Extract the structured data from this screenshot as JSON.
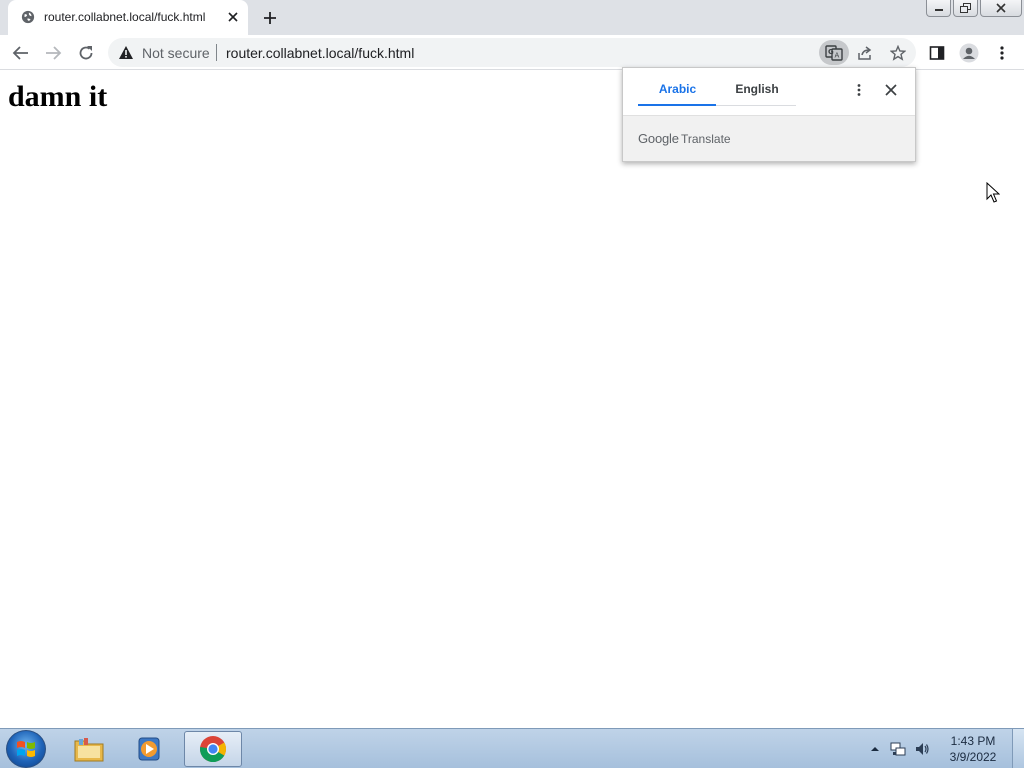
{
  "browser": {
    "tab": {
      "title": "router.collabnet.local/fuck.html",
      "favicon": "globe-icon"
    },
    "omnibox": {
      "security_label": "Not secure",
      "url": "router.collabnet.local/fuck.html"
    },
    "icons": {
      "back": "back-arrow-icon",
      "forward": "forward-arrow-icon",
      "reload": "reload-icon",
      "translate": "translate-icon",
      "share": "share-icon",
      "bookmark": "star-icon",
      "side_panel": "side-panel-icon",
      "profile": "profile-icon",
      "menu": "kebab-menu-icon"
    }
  },
  "page": {
    "heading": "damn it"
  },
  "translate_bubble": {
    "tabs": [
      {
        "label": "Arabic",
        "active": true
      },
      {
        "label": "English",
        "active": false
      }
    ],
    "footer_brand": "Google",
    "footer_product": "Translate",
    "accent_color": "#1a73e8"
  },
  "taskbar": {
    "clock_time": "1:43 PM",
    "clock_date": "3/9/2022",
    "pinned": [
      "file-explorer-icon",
      "media-player-icon",
      "chrome-icon"
    ]
  }
}
